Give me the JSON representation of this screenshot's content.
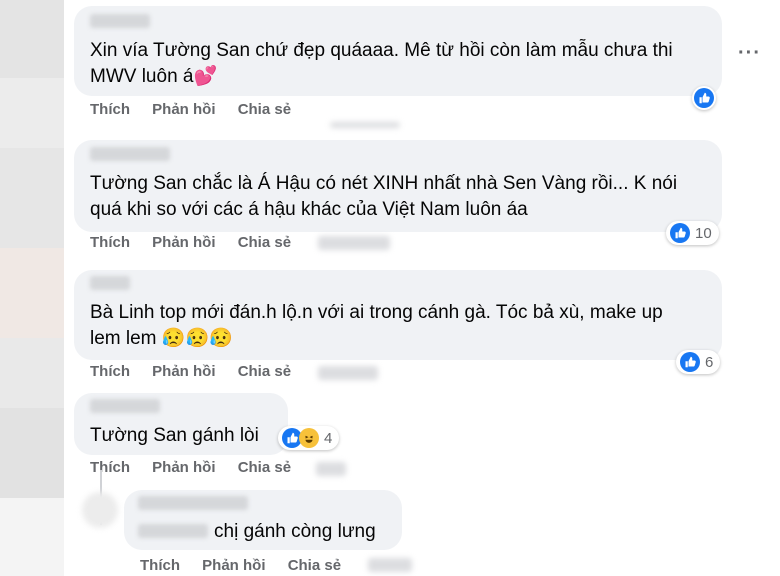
{
  "comments": [
    {
      "text_line1": "Xin vía Tường San chứ đẹp quáaaa. Mê từ hồi còn làm mẫu chưa thi",
      "text_line2": "MWV luôn á💕",
      "reaction_count": "",
      "actions": {
        "like": "Thích",
        "reply": "Phản hồi",
        "share": "Chia sẻ"
      }
    },
    {
      "text_line1": "Tường San chắc là Á Hậu có nét XINH nhất nhà Sen Vàng rồi... K nói",
      "text_line2": "quá khi so với các á hậu khác của Việt Nam luôn áa",
      "reaction_count": "10",
      "actions": {
        "like": "Thích",
        "reply": "Phản hồi",
        "share": "Chia sẻ"
      }
    },
    {
      "text_line1": "Bà Linh top mới đán.h lộ.n với ai trong cánh gà. Tóc bả xù, make up",
      "text_line2": "lem lem 😥😥😥",
      "reaction_count": "6",
      "actions": {
        "like": "Thích",
        "reply": "Phản hồi",
        "share": "Chia sẻ"
      }
    },
    {
      "text_line1": "Tường San gánh lòi",
      "reaction_count": "4",
      "actions": {
        "like": "Thích",
        "reply": "Phản hồi",
        "share": "Chia sẻ"
      }
    },
    {
      "text_line1": "chị gánh còng lưng",
      "actions": {
        "like": "Thích",
        "reply": "Phản hồi",
        "share": "Chia sẻ"
      }
    }
  ],
  "colors": {
    "bubble": "#f0f2f5",
    "like_blue": "#1877f2",
    "action_gray": "#65676b"
  },
  "icons": {
    "more": "more-options-icon",
    "like": "like-reaction-icon",
    "haha": "haha-reaction-icon"
  }
}
